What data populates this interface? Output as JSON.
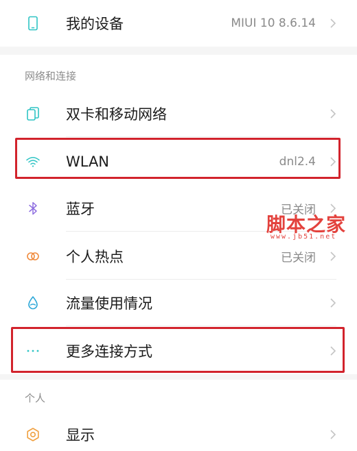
{
  "device_row": {
    "label": "我的设备",
    "value": "MIUI 10 8.6.14",
    "icon": "phone-icon"
  },
  "sections": {
    "network": "网络和连接",
    "personal": "个人"
  },
  "network_items": [
    {
      "label": "双卡和移动网络",
      "value": "",
      "icon": "dual-sim-icon"
    },
    {
      "label": "WLAN",
      "value": "dnl2.4",
      "icon": "wifi-icon"
    },
    {
      "label": "蓝牙",
      "value": "已关闭",
      "icon": "bluetooth-icon"
    },
    {
      "label": "个人热点",
      "value": "已关闭",
      "icon": "hotspot-icon"
    },
    {
      "label": "流量使用情况",
      "value": "",
      "icon": "data-drop-icon"
    },
    {
      "label": "更多连接方式",
      "value": "",
      "icon": "more-dots-icon"
    }
  ],
  "personal_items": [
    {
      "label": "显示",
      "value": "",
      "icon": "sun-icon"
    }
  ],
  "watermark": {
    "main": "脚本之家",
    "sub": "www.jb51.net"
  },
  "colors": {
    "highlight": "#d2232c",
    "accent_teal": "#2ec4c4",
    "watermark": "#e3423d"
  }
}
